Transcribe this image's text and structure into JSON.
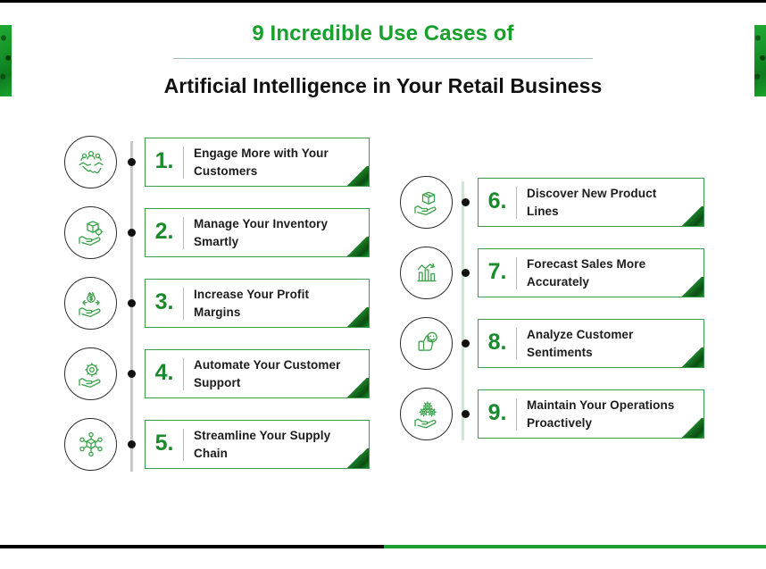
{
  "header": {
    "title_top": "9 Incredible Use Cases of",
    "title_bottom": "Artificial Intelligence in Your Retail Business",
    "accent_color": "#17a02c",
    "title_color": "#111111"
  },
  "theme": {
    "green": "#1a8a2c",
    "card_border": "#3f9a4e",
    "rail_left": "#c9c9c9",
    "rail_right": "#cde8d1",
    "dot": "#111111",
    "corner_triangle": "#0a4d12"
  },
  "left_column": {
    "items": [
      {
        "number": "1.",
        "line1": "Engage More with Your",
        "line2": "Customers",
        "icon": "handshake-people-icon"
      },
      {
        "number": "2.",
        "line1": "Manage Your Inventory",
        "line2": "Smartly",
        "icon": "hand-holding-box-gear-icon"
      },
      {
        "number": "3.",
        "line1": "Increase Your Profit",
        "line2": "Margins",
        "icon": "hand-holding-dollar-growth-icon"
      },
      {
        "number": "4.",
        "line1": "Automate Your Customer",
        "line2": "Support",
        "icon": "hand-holding-gear-icon"
      },
      {
        "number": "5.",
        "line1": "Streamline Your Supply",
        "line2": "Chain",
        "icon": "network-cube-icon"
      }
    ]
  },
  "right_column": {
    "items": [
      {
        "number": "6.",
        "line1": "Discover New Product",
        "line2": "Lines",
        "icon": "hand-holding-package-icon"
      },
      {
        "number": "7.",
        "line1": "Forecast Sales More",
        "line2": "Accurately",
        "icon": "bar-chart-arrow-up-icon"
      },
      {
        "number": "8.",
        "line1": "Analyze Customer",
        "line2": "Sentiments",
        "icon": "thumbs-up-smiley-icon"
      },
      {
        "number": "9.",
        "line1": "Maintain Your Operations",
        "line2": "Proactively",
        "icon": "hand-holding-gears-icon"
      }
    ]
  },
  "footer": {
    "rule_dark_color": "#000000",
    "rule_green_color": "#1f9e32"
  }
}
